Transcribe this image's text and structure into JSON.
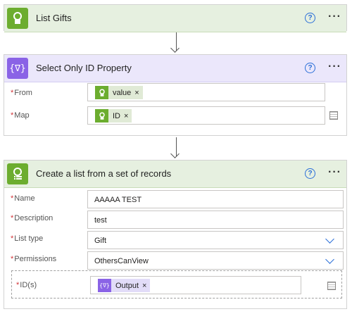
{
  "step1": {
    "title": "List Gifts",
    "help": "?",
    "more": "···"
  },
  "step2": {
    "title": "Select Only ID Property",
    "icon_text": "{∇}",
    "help": "?",
    "more": "···",
    "fields": {
      "from": {
        "label": "From",
        "token": "value",
        "remove": "×"
      },
      "map": {
        "label": "Map",
        "token": "ID",
        "remove": "×"
      }
    }
  },
  "step3": {
    "title": "Create a list from a set of records",
    "help": "?",
    "more": "···",
    "fields": {
      "name": {
        "label": "Name",
        "value": "AAAAA TEST"
      },
      "description": {
        "label": "Description",
        "value": "test"
      },
      "list_type": {
        "label": "List type",
        "value": "Gift"
      },
      "permissions": {
        "label": "Permissions",
        "value": "OthersCanView"
      },
      "ids": {
        "label": "ID(s)",
        "token": "Output",
        "token_icon": "{∇}",
        "remove": "×"
      }
    }
  },
  "required_mark": "*",
  "colors": {
    "green_accent": "#6cad2f",
    "purple_accent": "#8a63e6",
    "link_blue": "#2b6fd8",
    "required_red": "#d13438"
  },
  "icons": [
    "person-gift-icon",
    "data-operation-icon",
    "person-list-icon",
    "help-icon",
    "more-icon",
    "close-icon",
    "chevron-down-icon",
    "table-icon"
  ]
}
